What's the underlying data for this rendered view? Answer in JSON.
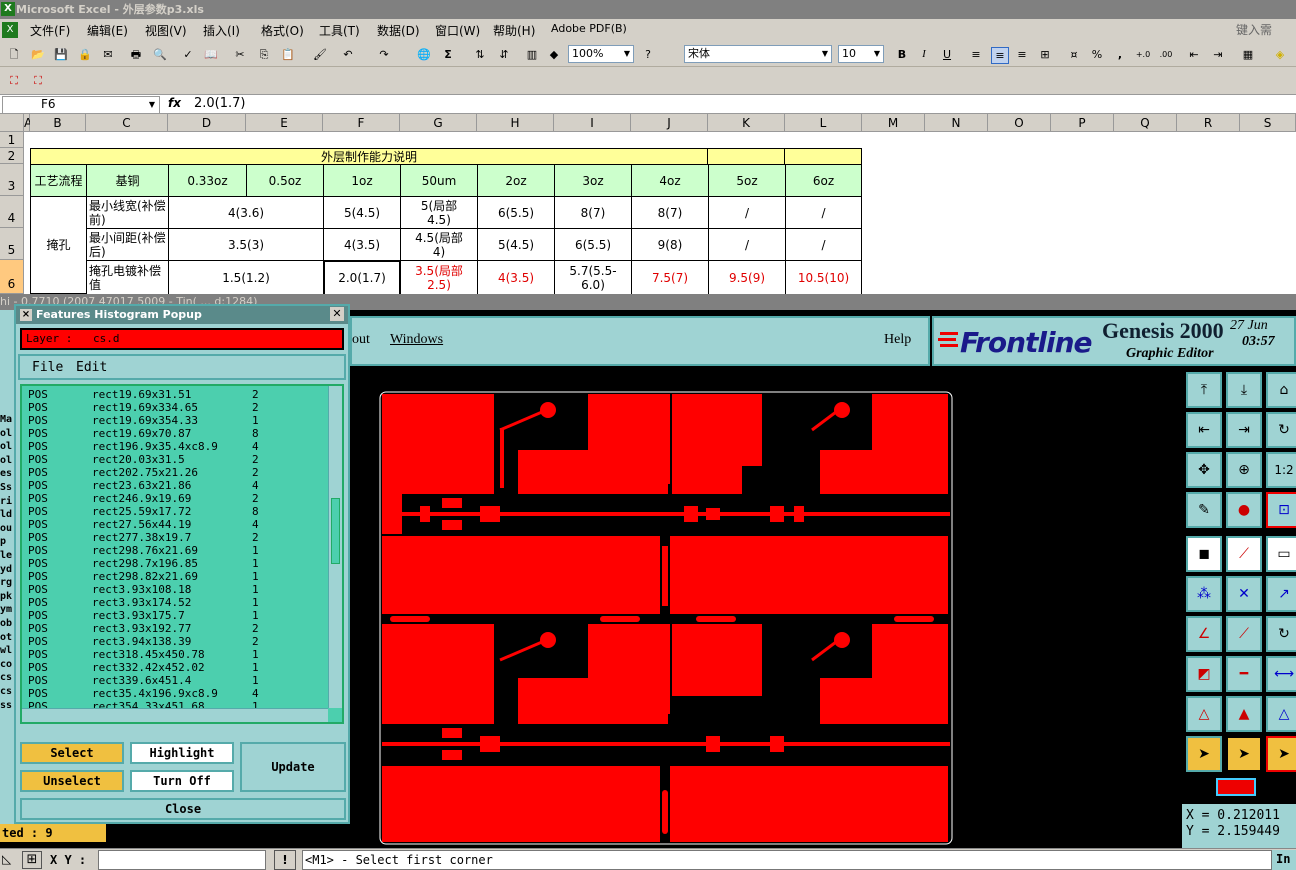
{
  "excel": {
    "title": "Microsoft Excel - 外层参数p3.xls",
    "help_box": "键入需",
    "menu": [
      "文件(F)",
      "编辑(E)",
      "视图(V)",
      "插入(I)",
      "格式(O)",
      "工具(T)",
      "数据(D)",
      "窗口(W)",
      "帮助(H)",
      "Adobe PDF(B)"
    ],
    "zoom": "100%",
    "font": "宋体",
    "font_size": "10",
    "bold": "B",
    "italic": "I",
    "underline": "U",
    "percent": "%",
    "comma": ",",
    "name_box": "F6",
    "fx": "fx",
    "formula": "2.0(1.7)",
    "columns": [
      "A",
      "B",
      "C",
      "D",
      "E",
      "F",
      "G",
      "H",
      "I",
      "J",
      "K",
      "L",
      "M",
      "N",
      "O",
      "P",
      "Q",
      "R",
      "S"
    ],
    "rows": [
      "1",
      "2",
      "3",
      "4",
      "5",
      "6"
    ],
    "table": {
      "title": "外层制作能力说明",
      "header": [
        "工艺流程",
        "基铜",
        "0.33oz",
        "0.5oz",
        "1oz",
        "50um",
        "2oz",
        "3oz",
        "4oz",
        "5oz",
        "6oz"
      ],
      "process": "掩孔",
      "row4": [
        "最小线宽(补偿前)",
        "4(3.6)",
        "5(4.5)",
        "5(局部4.5)",
        "6(5.5)",
        "8(7)",
        "8(7)",
        "/",
        "/"
      ],
      "row5": [
        "最小间距(补偿后)",
        "3.5(3)",
        "4(3.5)",
        "4.5(局部4)",
        "5(4.5)",
        "6(5.5)",
        "9(8)",
        "/",
        "/"
      ],
      "row6": [
        "掩孔电镀补偿值",
        "1.5(1.2)",
        "2.0(1.7)",
        "3.5(局部2.5)",
        "4(3.5)",
        "5.7(5.5-6.0)",
        "7.5(7)",
        "9.5(9)",
        "10.5(10)"
      ]
    }
  },
  "genesis": {
    "window_title": "hi      - 0.7710 (2007 47017 5009  -  Tin(  ...  d:1284)",
    "menu": [
      "out",
      "Windows",
      "Help"
    ],
    "brand": "Frontline",
    "product": "Genesis 2000",
    "subtitle": "Graphic Editor",
    "date": "27 Jun",
    "time": "03:57",
    "coord_x": "X = 0.212011",
    "coord_y": "Y = 2.159449",
    "status_xy": "X Y :",
    "status_msg": "<M1> - Select first corner",
    "status_right": "In",
    "selected": "ted : 9",
    "left_frags": [
      "Ma",
      "ol",
      "ol",
      "ol",
      "es",
      "Ss",
      "ri",
      "ld",
      "ou",
      "p",
      "le",
      "yd",
      "rg",
      "pk",
      "ym",
      "ob",
      "ot",
      "wl",
      "co",
      "cs",
      "cs",
      "ss"
    ]
  },
  "popup": {
    "title": "Features Histogram Popup",
    "layer_label": "Layer :",
    "layer_value": "cs.d",
    "menu_file": "File",
    "menu_edit": "Edit",
    "rows": [
      [
        "POS",
        "rect19.69x31.51",
        "2"
      ],
      [
        "POS",
        "rect19.69x334.65",
        "2"
      ],
      [
        "POS",
        "rect19.69x354.33",
        "1"
      ],
      [
        "POS",
        "rect19.69x70.87",
        "8"
      ],
      [
        "POS",
        "rect196.9x35.4xc8.9",
        "4"
      ],
      [
        "POS",
        "rect20.03x31.5",
        "2"
      ],
      [
        "POS",
        "rect202.75x21.26",
        "2"
      ],
      [
        "POS",
        "rect23.63x21.86",
        "4"
      ],
      [
        "POS",
        "rect246.9x19.69",
        "2"
      ],
      [
        "POS",
        "rect25.59x17.72",
        "8"
      ],
      [
        "POS",
        "rect27.56x44.19",
        "4"
      ],
      [
        "POS",
        "rect277.38x19.7",
        "2"
      ],
      [
        "POS",
        "rect298.76x21.69",
        "1"
      ],
      [
        "POS",
        "rect298.7x196.85",
        "1"
      ],
      [
        "POS",
        "rect298.82x21.69",
        "1"
      ],
      [
        "POS",
        "rect3.93x108.18",
        "1"
      ],
      [
        "POS",
        "rect3.93x174.52",
        "1"
      ],
      [
        "POS",
        "rect3.93x175.7",
        "1"
      ],
      [
        "POS",
        "rect3.93x192.77",
        "2"
      ],
      [
        "POS",
        "rect3.94x138.39",
        "2"
      ],
      [
        "POS",
        "rect318.45x450.78",
        "1"
      ],
      [
        "POS",
        "rect332.42x452.02",
        "1"
      ],
      [
        "POS",
        "rect339.6x451.4",
        "1"
      ],
      [
        "POS",
        "rect35.4x196.9xc8.9",
        "4"
      ],
      [
        "POS",
        "rect354.33x451.68",
        "1"
      ]
    ],
    "btn_select": "Select",
    "btn_highlight": "Highlight",
    "btn_unselect": "Unselect",
    "btn_turnoff": "Turn Off",
    "btn_update": "Update",
    "btn_close": "Close"
  }
}
